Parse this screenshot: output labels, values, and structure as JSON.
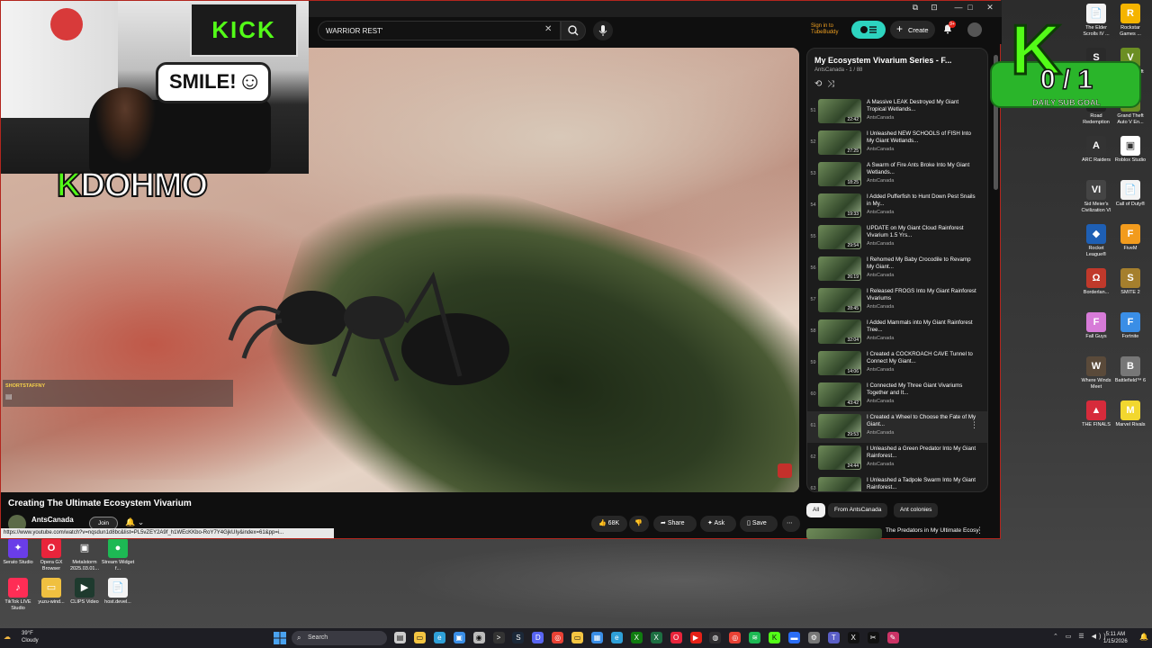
{
  "browser": {
    "search_value": "WARRIOR REST'",
    "sign_in_label": "Sign in to TubeBuddy",
    "create_label": "Create",
    "notification_count": "9+",
    "chrome_buttons": [
      "⧉",
      "⊡",
      "—",
      "□",
      "✕"
    ]
  },
  "stream_overlay": {
    "kick_banner": "KICK",
    "smile_text": "SMILE!",
    "streamer_k": "K",
    "streamer_name": "DOHMO",
    "chat_username": "SHORTSTAFFNY"
  },
  "video": {
    "title": "Creating The Ultimate Ecosystem Vivarium",
    "channel": "AntsCanada",
    "join_label": "Join",
    "like_count": "68K",
    "share_label": "Share",
    "ask_label": "Ask",
    "save_label": "Save",
    "status_url": "https://www.youtube.com/watch?v=nqsdun1d8bc&list=PL5vZEY2A9f_h1WEcKKbo-RoY7Y4GjkUIy&index=61&pp=i..."
  },
  "playlist": {
    "title": "My Ecosystem Vivarium Series - F...",
    "subtitle": "AntsCanada - 1 / 88",
    "items": [
      {
        "num": "51",
        "duration": "22:42",
        "title": "A Massive LEAK Destroyed My Giant Tropical Wetlands...",
        "channel": "AntsCanada"
      },
      {
        "num": "52",
        "duration": "27:25",
        "title": "I Unleashed NEW SCHOOLS of FISH Into My Giant Wetlands...",
        "channel": "AntsCanada"
      },
      {
        "num": "53",
        "duration": "18:25",
        "title": "A Swarm of Fire Ants Broke Into My Giant Wetlands...",
        "channel": "AntsCanada"
      },
      {
        "num": "54",
        "duration": "19:33",
        "title": "I Added Pufferfish to Hunt Down Pest Snails in My...",
        "channel": "AntsCanada"
      },
      {
        "num": "55",
        "duration": "29:54",
        "title": "UPDATE on My Giant Cloud Rainforest Vivarium 1.5 Yrs...",
        "channel": "AntsCanada"
      },
      {
        "num": "56",
        "duration": "26:19",
        "title": "I Rehomed My Baby Crocodile to Revamp My Giant...",
        "channel": "AntsCanada"
      },
      {
        "num": "57",
        "duration": "28:45",
        "title": "I Released FROGS Into My Giant Rainforest Vivariums",
        "channel": "AntsCanada"
      },
      {
        "num": "58",
        "duration": "32:04",
        "title": "I Added Mammals into My Giant Rainforest Tree...",
        "channel": "AntsCanada"
      },
      {
        "num": "59",
        "duration": "14:06",
        "title": "I Created a COCKROACH CAVE Tunnel to Connect My Giant...",
        "channel": "AntsCanada"
      },
      {
        "num": "60",
        "duration": "43:42",
        "title": "I Connected My Three Giant Vivariums Together and It...",
        "channel": "AntsCanada"
      },
      {
        "num": "61",
        "duration": "29:53",
        "title": "I Created a Wheel to Choose the Fate of My Giant...",
        "channel": "AntsCanada"
      },
      {
        "num": "62",
        "duration": "24:44",
        "title": "I Unleashed a Green Predator Into My Giant Rainforest...",
        "channel": "AntsCanada"
      },
      {
        "num": "63",
        "duration": "",
        "title": "I Unleashed a Tadpole Swarm Into My Giant Rainforest...",
        "channel": ""
      }
    ],
    "chips": [
      "All",
      "From AntsCanada",
      "Ant colonies"
    ],
    "next_title": "The Predators in My Ultimate Ecosystem Vivarium"
  },
  "sub_goal": {
    "k": "K",
    "count": "0 / 1",
    "label": "DAILY SUB GOAL"
  },
  "desktop_icons_right": [
    {
      "label": "The Elder Scrolls IV ...",
      "color": "#f4f4f4",
      "glyph": "📄"
    },
    {
      "label": "Rockstar Games ...",
      "color": "#f5b400",
      "glyph": "R"
    },
    {
      "label": "Skate",
      "color": "#2a2a2a",
      "glyph": "S"
    },
    {
      "label": "Grand Theft Auto V",
      "color": "#6b8e23",
      "glyph": "V"
    },
    {
      "label": "Road Redemption",
      "color": "#222222",
      "glyph": "R"
    },
    {
      "label": "Grand Theft Auto V En...",
      "color": "#6b8e23",
      "glyph": "V"
    },
    {
      "label": "ARC Raiders",
      "color": "#333333",
      "glyph": "A"
    },
    {
      "label": "Roblox Studio",
      "color": "#ffffff",
      "glyph": "▣"
    },
    {
      "label": "Sid Meier's Civilization VI",
      "color": "#444444",
      "glyph": "VI"
    },
    {
      "label": "Call of Duty®",
      "color": "#f4f4f4",
      "glyph": "📄"
    },
    {
      "label": "Rocket League®",
      "color": "#1e5fb4",
      "glyph": "◆"
    },
    {
      "label": "FiveM",
      "color": "#f29b1d",
      "glyph": "F"
    },
    {
      "label": "Borderlan...",
      "color": "#c0392b",
      "glyph": "Ω"
    },
    {
      "label": "SMITE 2",
      "color": "#a57f2d",
      "glyph": "S"
    },
    {
      "label": "Fall Guys",
      "color": "#d77bd8",
      "glyph": "F"
    },
    {
      "label": "Fortnite",
      "color": "#3a8ee6",
      "glyph": "F"
    },
    {
      "label": "Where Winds Meet",
      "color": "#5a4a3a",
      "glyph": "W"
    },
    {
      "label": "Battlefield™ 6",
      "color": "#777777",
      "glyph": "B"
    },
    {
      "label": "THE FINALS",
      "color": "#d62b3b",
      "glyph": "▲"
    },
    {
      "label": "Marvel Rivals",
      "color": "#f2d72f",
      "glyph": "M"
    }
  ],
  "desktop_icons_left": [
    {
      "label": "Serato Studio",
      "color": "#6a3de8",
      "glyph": "✦"
    },
    {
      "label": "Opera GX Browser",
      "color": "#e8243b",
      "glyph": "O"
    },
    {
      "label": "Metalstorm 2025.03.01...",
      "color": "#444444",
      "glyph": "▣"
    },
    {
      "label": "Stream Widget f...",
      "color": "#1db954",
      "glyph": "●"
    },
    {
      "label": "TikTok LIVE Studio",
      "color": "#ff2d55",
      "glyph": "♪"
    },
    {
      "label": "yuzu-wind...",
      "color": "#f0c040",
      "glyph": "▭"
    },
    {
      "label": "CLIPS Video",
      "color": "#1e3a2e",
      "glyph": "▶"
    },
    {
      "label": "host.devel...",
      "color": "#f4f4f4",
      "glyph": "📄"
    }
  ],
  "taskbar": {
    "weather_temp": "39°F",
    "weather_desc": "Cloudy",
    "search_placeholder": "Search",
    "time": "5:11 AM",
    "date": "1/15/2026",
    "icons": [
      {
        "name": "task-view",
        "color": "#cccccc",
        "glyph": "▤"
      },
      {
        "name": "file-explorer",
        "color": "#f4c542",
        "glyph": "▭"
      },
      {
        "name": "edge",
        "color": "#2fa0d8",
        "glyph": "e"
      },
      {
        "name": "photos",
        "color": "#3a8ee6",
        "glyph": "▣"
      },
      {
        "name": "camera",
        "color": "#bbbbbb",
        "glyph": "◉"
      },
      {
        "name": "terminal",
        "color": "#333333",
        "glyph": ">"
      },
      {
        "name": "steam",
        "color": "#1b2838",
        "glyph": "S"
      },
      {
        "name": "discord",
        "color": "#5865f2",
        "glyph": "D"
      },
      {
        "name": "chrome",
        "color": "#e94235",
        "glyph": "◎"
      },
      {
        "name": "folder",
        "color": "#f4c542",
        "glyph": "▭"
      },
      {
        "name": "store",
        "color": "#3a8ee6",
        "glyph": "▦"
      },
      {
        "name": "edge-2",
        "color": "#2fa0d8",
        "glyph": "e"
      },
      {
        "name": "xbox",
        "color": "#107c10",
        "glyph": "X"
      },
      {
        "name": "excel",
        "color": "#1d6f42",
        "glyph": "X"
      },
      {
        "name": "opera",
        "color": "#e8243b",
        "glyph": "O"
      },
      {
        "name": "youtube",
        "color": "#e62117",
        "glyph": "▶"
      },
      {
        "name": "obs",
        "color": "#302e31",
        "glyph": "◍"
      },
      {
        "name": "chrome-2",
        "color": "#e94235",
        "glyph": "◎"
      },
      {
        "name": "spotify",
        "color": "#1db954",
        "glyph": "≋"
      },
      {
        "name": "kick",
        "color": "#53fc18",
        "glyph": "K"
      },
      {
        "name": "winget",
        "color": "#2a6df4",
        "glyph": "▬"
      },
      {
        "name": "settings",
        "color": "#777777",
        "glyph": "⚙"
      },
      {
        "name": "teams",
        "color": "#5b5fc7",
        "glyph": "T"
      },
      {
        "name": "x-app",
        "color": "#111111",
        "glyph": "X"
      },
      {
        "name": "capcut",
        "color": "#111111",
        "glyph": "✂"
      },
      {
        "name": "snip",
        "color": "#cc3366",
        "glyph": "✎"
      }
    ]
  }
}
